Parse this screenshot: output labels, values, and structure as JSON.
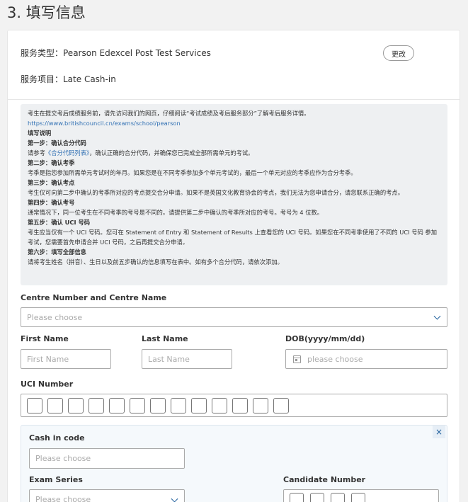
{
  "page": {
    "title": "3. 填写信息"
  },
  "service": {
    "type_label": "服务类型",
    "type_value": "Pearson Edexcel Post Test Services",
    "type_text": "服务类型：Pearson Edexcel Post Test Services",
    "item_text": "服务项目：Late Cash-in",
    "change_button": "更改"
  },
  "notice": {
    "intro": "考生在提交考后成绩服务前，请先访问我们的网页，仔细阅读“考试成绩及考后服务部分”了解考后服务详情。",
    "url": "https://www.britishcouncil.cn/exams/school/pearson",
    "heading": "填写说明",
    "step1_title": "第一步：确认合分代码",
    "step1_pre": "请参考",
    "step1_link": "《合分代码列表》",
    "step1_post": "，确认正确的合分代码，并确保您已完成全部所需单元的考试。",
    "step2_title": "第二步：确认考季",
    "step2_body": "考季是指您参加所需单元考试时的年月。如果您是在不同考季参加多个单元考试的，最后一个单元对应的考季应作为合分考季。",
    "step3_title": "第三步：确认考点",
    "step3_body": "考生仅可向第二步中确认的考季所对应的考点提交合分申请。如果不是英国文化教育协会的考点，我们无法为您申请合分，请您联系正确的考点。",
    "step4_title": "第四步：确认考号",
    "step4_body": "通常情况下，同一位考生在不同考季的考号是不同的。请提供第二步中确认的考季所对应的考号。考号为 4 位数。",
    "step5_title": "第五步：确认 UCI 号码",
    "step5_body": "考生应当仅有一个 UCI 号码。您可在 Statement of Entry 和 Statement of Results 上查看您的 UCI 号码。如果您在不同考季使用了不同的 UCI 号码 参加考试，您需要首先申请合并 UCI 号码，之后再提交合分申请。",
    "step6_title": "第六步：填写全部信息",
    "step6_body": "请将考生姓名（拼音）、生日以及前五步确认的信息填写在表中。如有多个合分代码，请依次添加。"
  },
  "form": {
    "centre_label": "Centre Number and Centre Name",
    "centre_placeholder": "Please choose",
    "first_name_label": "First Name",
    "first_name_placeholder": "First Name",
    "last_name_label": "Last Name",
    "last_name_placeholder": "Last Name",
    "dob_label": "DOB(yyyy/mm/dd)",
    "dob_placeholder": "please choose",
    "uci_label": "UCI Number",
    "uci_cell_count": 13,
    "cash_in_label": "Cash in code",
    "cash_in_placeholder": "Please choose",
    "exam_series_label": "Exam Series",
    "exam_series_placeholder": "Please choose",
    "candidate_number_label": "Candidate Number",
    "candidate_cell_count": 4,
    "close_icon": "×"
  },
  "colors": {
    "link": "#2f6fb3",
    "accent": "#1f5f9c",
    "notice_bg": "#eef0f2",
    "panel_bg": "#f5f9fc"
  }
}
